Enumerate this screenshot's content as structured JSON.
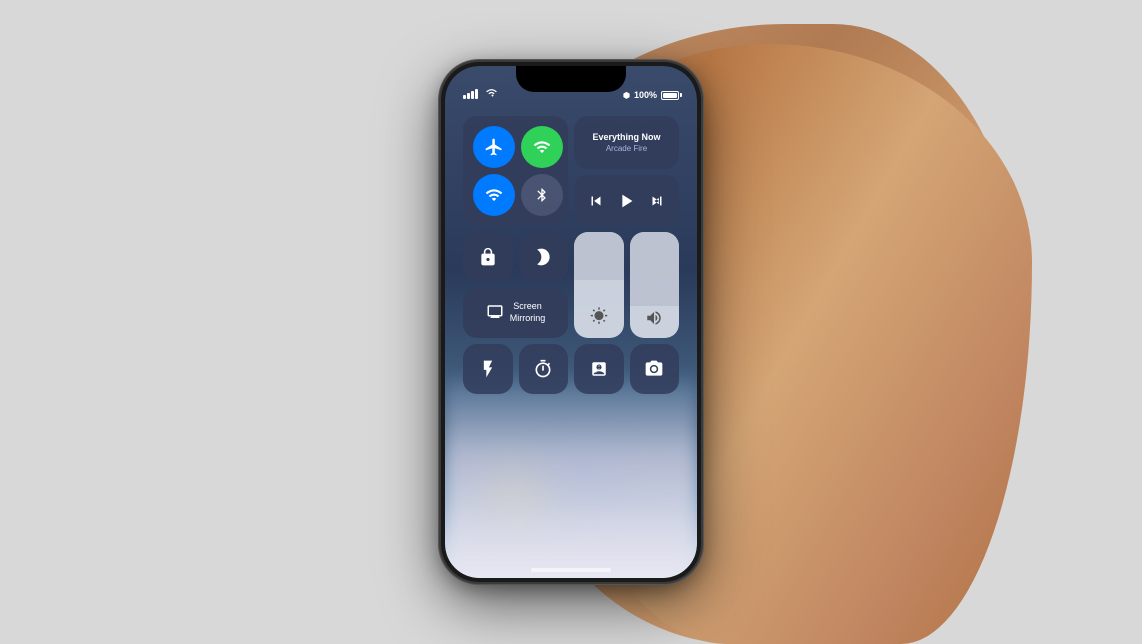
{
  "background": {
    "color": "#d8d8d8"
  },
  "phone": {
    "status_bar": {
      "signal": "●●●",
      "wifi": "wifi",
      "bluetooth": "B",
      "battery_pct": "100%",
      "battery_icon": "battery"
    },
    "control_center": {
      "connectivity": {
        "airplane_mode": "active",
        "cellular": "active",
        "wifi": "active",
        "bluetooth": "inactive"
      },
      "now_playing": {
        "title": "Everything Now",
        "artist": "Arcade Fire"
      },
      "media": {
        "rewind": "⏮",
        "play": "▶",
        "fast_forward": "⏭"
      },
      "tiles": {
        "portrait_lock": "🔒",
        "do_not_disturb": "🌙",
        "screen_mirroring_label": "Screen\nMirroring",
        "brightness_icon": "☀",
        "volume_icon": "🔊",
        "flashlight": "🔦",
        "timer": "⏱",
        "calculator": "🧮",
        "camera": "📷"
      }
    },
    "home_indicator": true
  }
}
